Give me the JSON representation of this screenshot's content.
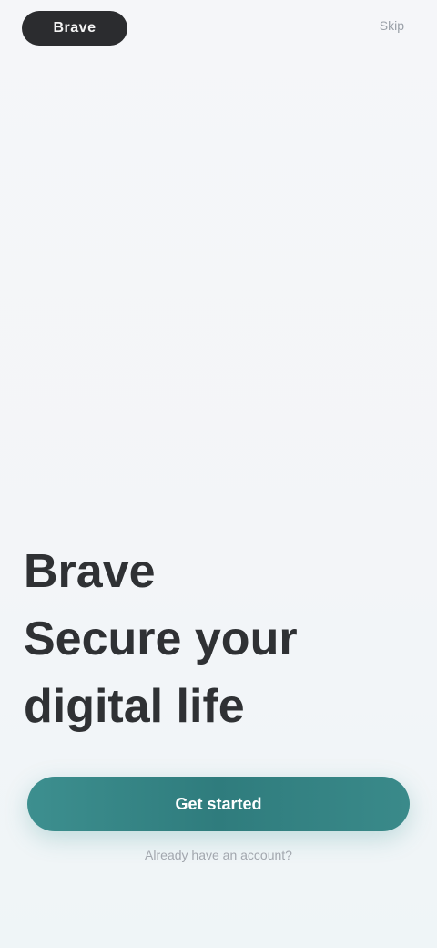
{
  "header": {
    "logo_text": "Brave",
    "top_link": "Skip"
  },
  "hero": {
    "brand": "Brave",
    "headline": "Secure your digital life"
  },
  "cta": {
    "label": "Get started"
  },
  "footer": {
    "link": "Already have an account?"
  },
  "colors": {
    "background": "#f3f5f8",
    "accent": "#2f7c7d",
    "text": "#2f3134"
  }
}
